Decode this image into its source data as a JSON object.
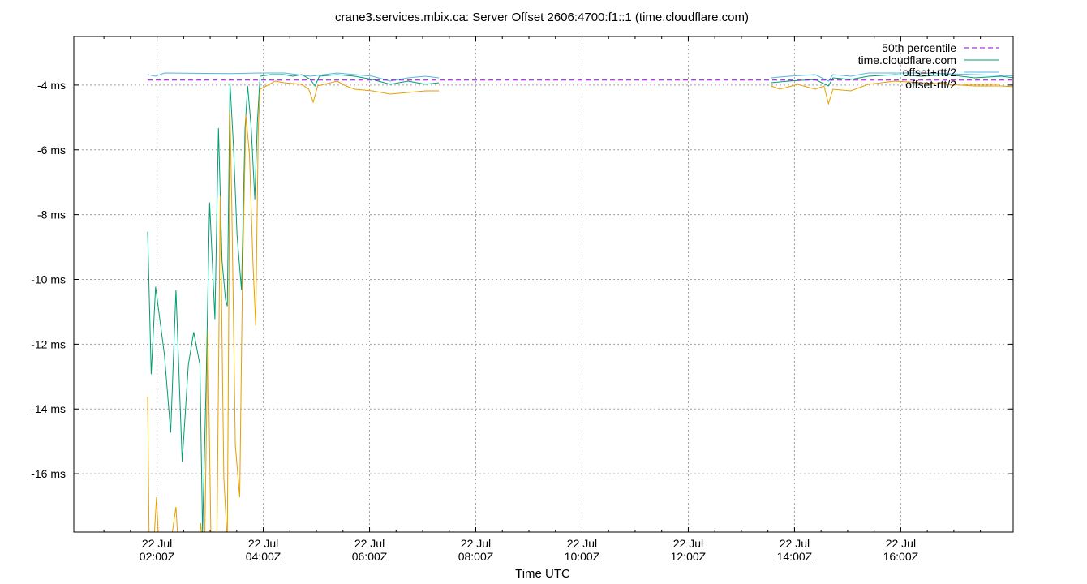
{
  "chart_data": {
    "type": "line",
    "title": "crane3.services.mbix.ca: Server Offset 2606:4700:f1::1 (time.cloudflare.com)",
    "xlabel": "Time UTC",
    "ylabel": "",
    "y_unit": "ms",
    "xlim": [
      "2025-07-21T00:26Z",
      "2025-07-22T18:07Z"
    ],
    "ylim": [
      -17.8,
      -2.5
    ],
    "grid": true,
    "legend_position": "top-right",
    "y_ticks": [
      {
        "value": -4,
        "label": "-4 ms"
      },
      {
        "value": -6,
        "label": "-6 ms"
      },
      {
        "value": -8,
        "label": "-8 ms"
      },
      {
        "value": -10,
        "label": "-10 ms"
      },
      {
        "value": -12,
        "label": "-12 ms"
      },
      {
        "value": -14,
        "label": "-14 ms"
      },
      {
        "value": -16,
        "label": "-16 ms"
      }
    ],
    "x_ticks": [
      {
        "time": "02:00",
        "line1": "22 Jul",
        "line2": "02:00Z"
      },
      {
        "time": "04:00",
        "line1": "22 Jul",
        "line2": "04:00Z"
      },
      {
        "time": "06:00",
        "line1": "22 Jul",
        "line2": "06:00Z"
      },
      {
        "time": "08:00",
        "line1": "22 Jul",
        "line2": "08:00Z"
      },
      {
        "time": "10:00",
        "line1": "22 Jul",
        "line2": "10:00Z"
      },
      {
        "time": "12:00",
        "line1": "22 Jul",
        "line2": "12:00Z"
      },
      {
        "time": "14:00",
        "line1": "22 Jul",
        "line2": "14:00Z"
      },
      {
        "time": "16:00",
        "line1": "22 Jul",
        "line2": "16:00Z"
      }
    ],
    "percentile_50": -2.72,
    "series": [
      {
        "name": "50th percentile",
        "color": "#9400d3",
        "style": "dashed",
        "points": [
          [
            "00:26",
            -2.72
          ],
          [
            "18:07",
            -2.72
          ]
        ]
      },
      {
        "name": "time.cloudflare.com",
        "color": "#009e73",
        "style": "solid",
        "points": [
          [
            "00:26",
            -7.4
          ],
          [
            "00:30",
            -11.8
          ],
          [
            "00:35",
            -9.1
          ],
          [
            "00:45",
            -11.2
          ],
          [
            "00:52",
            -13.6
          ],
          [
            "00:58",
            -9.2
          ],
          [
            "01:05",
            -14.5
          ],
          [
            "01:12",
            -11.5
          ],
          [
            "01:18",
            -10.5
          ],
          [
            "01:25",
            -11.5
          ],
          [
            "01:28",
            -16.7
          ],
          [
            "01:32",
            -12.2
          ],
          [
            "01:36",
            -6.5
          ],
          [
            "01:42",
            -10.1
          ],
          [
            "01:46",
            -4.2
          ],
          [
            "01:50",
            -8.3
          ],
          [
            "01:54",
            -9.5
          ],
          [
            "01:56",
            -9.7
          ],
          [
            "01:59",
            -2.8
          ],
          [
            "02:03",
            -4.8
          ],
          [
            "02:07",
            -7.5
          ],
          [
            "02:12",
            -9.2
          ],
          [
            "02:16",
            -4.2
          ],
          [
            "02:19",
            -2.9
          ],
          [
            "02:23",
            -4.2
          ],
          [
            "02:27",
            -6.4
          ],
          [
            "02:30",
            -4.0
          ],
          [
            "02:33",
            -2.6
          ],
          [
            "02:45",
            -2.55
          ],
          [
            "03:00",
            -2.55
          ],
          [
            "03:10",
            -2.6
          ],
          [
            "03:20",
            -2.55
          ],
          [
            "03:30",
            -2.7
          ],
          [
            "03:35",
            -2.9
          ],
          [
            "03:40",
            -2.6
          ],
          [
            "04:00",
            -2.55
          ],
          [
            "04:20",
            -2.6
          ],
          [
            "04:40",
            -2.7
          ],
          [
            "05:00",
            -2.85
          ],
          [
            "05:20",
            -2.75
          ],
          [
            "05:40",
            -2.85
          ],
          [
            "05:55",
            -2.8
          ],
          null,
          [
            "12:10",
            -2.8
          ],
          [
            "12:30",
            -2.75
          ],
          [
            "13:00",
            -2.7
          ],
          [
            "13:15",
            -2.9
          ],
          [
            "13:20",
            -2.65
          ],
          [
            "13:40",
            -2.7
          ],
          [
            "14:00",
            -2.6
          ],
          [
            "14:30",
            -2.55
          ],
          [
            "15:00",
            -2.6
          ],
          [
            "15:30",
            -2.55
          ],
          [
            "16:00",
            -2.65
          ],
          [
            "16:30",
            -2.6
          ],
          [
            "17:00",
            -2.7
          ],
          [
            "17:30",
            -2.75
          ],
          [
            "18:07",
            -2.65
          ]
        ]
      },
      {
        "name": "offset+rtt/2",
        "color": "#56b4e9",
        "style": "solid",
        "points": [
          [
            "00:26",
            -2.55
          ],
          [
            "00:35",
            -2.6
          ],
          [
            "00:45",
            -2.5
          ],
          [
            "02:00",
            -2.52
          ],
          [
            "02:33",
            -2.5
          ],
          [
            "03:00",
            -2.5
          ],
          [
            "03:30",
            -2.6
          ],
          [
            "04:00",
            -2.5
          ],
          [
            "04:40",
            -2.6
          ],
          [
            "05:00",
            -2.75
          ],
          [
            "05:20",
            -2.65
          ],
          [
            "05:40",
            -2.6
          ],
          [
            "05:55",
            -2.65
          ],
          null,
          [
            "12:10",
            -2.65
          ],
          [
            "12:30",
            -2.6
          ],
          [
            "13:00",
            -2.55
          ],
          [
            "13:15",
            -2.75
          ],
          [
            "13:20",
            -2.55
          ],
          [
            "13:40",
            -2.6
          ],
          [
            "14:00",
            -2.5
          ],
          [
            "15:00",
            -2.5
          ],
          [
            "16:00",
            -2.55
          ],
          [
            "17:00",
            -2.6
          ],
          [
            "17:30",
            -2.55
          ],
          [
            "18:07",
            -2.5
          ]
        ]
      },
      {
        "name": "offset-rtt/2",
        "color": "#e69f00",
        "style": "solid",
        "points": [
          [
            "00:26",
            -12.5
          ],
          [
            "00:28",
            -17.8
          ],
          [
            "00:32",
            -17.5
          ],
          [
            "00:36",
            -15.6
          ],
          [
            "00:40",
            -17.8
          ],
          [
            "00:48",
            -17.8
          ],
          [
            "00:58",
            -15.9
          ],
          [
            "01:02",
            -17.8
          ],
          [
            "01:22",
            -17.8
          ],
          [
            "01:26",
            -16.4
          ],
          [
            "01:30",
            -17.8
          ],
          [
            "01:34",
            -10.5
          ],
          [
            "01:38",
            -17.8
          ],
          [
            "01:44",
            -17.8
          ],
          [
            "01:48",
            -6.3
          ],
          [
            "01:52",
            -15.0
          ],
          [
            "01:56",
            -17.0
          ],
          [
            "01:59",
            -3.7
          ],
          [
            "02:01",
            -6.5
          ],
          [
            "02:05",
            -14.0
          ],
          [
            "02:10",
            -15.6
          ],
          [
            "02:13",
            -9.0
          ],
          [
            "02:17",
            -3.8
          ],
          [
            "02:21",
            -5.0
          ],
          [
            "02:25",
            -8.4
          ],
          [
            "02:28",
            -10.3
          ],
          [
            "02:31",
            -4.2
          ],
          [
            "02:33",
            -3.0
          ],
          [
            "02:40",
            -2.9
          ],
          [
            "02:50",
            -2.75
          ],
          [
            "03:00",
            -2.8
          ],
          [
            "03:20",
            -2.85
          ],
          [
            "03:28",
            -3.0
          ],
          [
            "03:33",
            -3.4
          ],
          [
            "03:38",
            -2.9
          ],
          [
            "04:00",
            -2.75
          ],
          [
            "04:10",
            -2.9
          ],
          [
            "04:20",
            -3.0
          ],
          [
            "04:40",
            -3.05
          ],
          [
            "05:00",
            -3.15
          ],
          [
            "05:20",
            -3.1
          ],
          [
            "05:40",
            -3.05
          ],
          [
            "05:55",
            -3.05
          ],
          null,
          [
            "12:10",
            -2.9
          ],
          [
            "12:20",
            -3.0
          ],
          [
            "12:40",
            -2.85
          ],
          [
            "13:00",
            -3.0
          ],
          [
            "13:10",
            -2.9
          ],
          [
            "13:15",
            -3.45
          ],
          [
            "13:20",
            -3.0
          ],
          [
            "13:40",
            -3.05
          ],
          [
            "14:00",
            -2.85
          ],
          [
            "14:30",
            -2.75
          ],
          [
            "15:00",
            -2.8
          ],
          [
            "15:30",
            -2.85
          ],
          [
            "16:00",
            -2.9
          ],
          [
            "16:30",
            -2.9
          ],
          [
            "17:00",
            -2.95
          ],
          [
            "17:30",
            -2.95
          ],
          [
            "18:07",
            -3.0
          ]
        ]
      }
    ]
  }
}
